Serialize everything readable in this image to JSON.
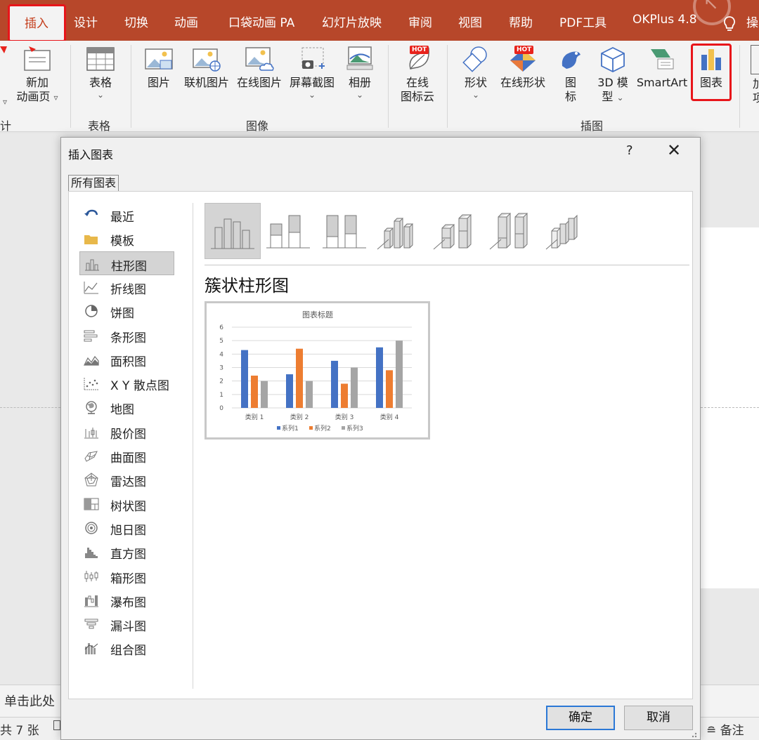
{
  "tabs": [
    {
      "id": "insert",
      "label": "插入"
    },
    {
      "id": "design",
      "label": "设计"
    },
    {
      "id": "transitions",
      "label": "切换"
    },
    {
      "id": "animations",
      "label": "动画"
    },
    {
      "id": "pocket-animation",
      "label": "口袋动画 PA"
    },
    {
      "id": "slideshow",
      "label": "幻灯片放映"
    },
    {
      "id": "review",
      "label": "审阅"
    },
    {
      "id": "view",
      "label": "视图"
    },
    {
      "id": "help",
      "label": "帮助"
    },
    {
      "id": "pdf-tools",
      "label": "PDF工具"
    },
    {
      "id": "okplus",
      "label": "OKPlus 4.8"
    },
    {
      "id": "cut",
      "label": "操"
    }
  ],
  "ribbon": {
    "new_anim_page": {
      "line1": "新加",
      "line2": "动画页",
      "arrow_left": "▿",
      "arrow_right": "▿"
    },
    "table": {
      "label": "表格",
      "caret": "⌄",
      "group": "表格"
    },
    "image_group": {
      "picture": "图片",
      "online_picture_1": "联机图片",
      "online_picture_2": "在线图片",
      "screenshot": "屏幕截图",
      "album": "相册",
      "caret": "⌄",
      "group": "图像"
    },
    "icon_cloud": {
      "line1": "在线",
      "line2": "图标云",
      "hot": "HOT"
    },
    "illus_group": {
      "shapes": "形状",
      "online_shapes": "在线形状",
      "icons_line1": "图",
      "icons_line2": "标",
      "model3d_line1": "3D 模",
      "model3d_line2": "型",
      "smartart": "SmartArt",
      "chart": "图表",
      "caret": "⌄",
      "hot": "HOT",
      "group": "插图"
    },
    "left_partial_group": "计",
    "right_partial": "加\n项"
  },
  "dialog": {
    "title": "插入图表",
    "help": "?",
    "close": "✕",
    "tab": "所有图表",
    "categories": [
      {
        "label": "最近",
        "icon": "recent-icon"
      },
      {
        "label": "模板",
        "icon": "folder-icon"
      },
      {
        "label": "柱形图",
        "icon": "column-chart-icon"
      },
      {
        "label": "折线图",
        "icon": "line-chart-icon"
      },
      {
        "label": "饼图",
        "icon": "pie-chart-icon"
      },
      {
        "label": "条形图",
        "icon": "bar-chart-icon"
      },
      {
        "label": "面积图",
        "icon": "area-chart-icon"
      },
      {
        "label": "X Y 散点图",
        "icon": "scatter-chart-icon"
      },
      {
        "label": "地图",
        "icon": "globe-icon"
      },
      {
        "label": "股价图",
        "icon": "stock-chart-icon"
      },
      {
        "label": "曲面图",
        "icon": "surface-chart-icon"
      },
      {
        "label": "雷达图",
        "icon": "radar-chart-icon"
      },
      {
        "label": "树状图",
        "icon": "treemap-icon"
      },
      {
        "label": "旭日图",
        "icon": "sunburst-icon"
      },
      {
        "label": "直方图",
        "icon": "histogram-icon"
      },
      {
        "label": "箱形图",
        "icon": "boxplot-icon"
      },
      {
        "label": "瀑布图",
        "icon": "waterfall-icon"
      },
      {
        "label": "漏斗图",
        "icon": "funnel-icon"
      },
      {
        "label": "组合图",
        "icon": "combo-chart-icon"
      }
    ],
    "selected_category": "柱形图",
    "subtypes_count": 7,
    "selected_subtype_title": "簇状柱形图",
    "ok": "确定",
    "cancel": "取消"
  },
  "preview_chart": {
    "chart_data": {
      "type": "bar",
      "title": "图表标题",
      "categories": [
        "类别 1",
        "类别 2",
        "类别 3",
        "类别 4"
      ],
      "series": [
        {
          "name": "系列1",
          "values": [
            4.3,
            2.5,
            3.5,
            4.5
          ],
          "color": "#4472c4"
        },
        {
          "name": "系列2",
          "values": [
            2.4,
            4.4,
            1.8,
            2.8
          ],
          "color": "#ed7d31"
        },
        {
          "name": "系列3",
          "values": [
            2.0,
            2.0,
            3.0,
            5.0
          ],
          "color": "#a5a5a5"
        }
      ],
      "ylim": [
        0,
        6
      ],
      "yticks": [
        "0",
        "1",
        "2",
        "3",
        "4",
        "5",
        "6"
      ],
      "grid": true,
      "legend": "bottom"
    }
  },
  "slide_pane": {
    "notes_placeholder": "单击此处",
    "slide_count": "共 7 张",
    "notes_button": "备注"
  },
  "colors": {
    "accent": "#b7472a",
    "highlight": "#e8151a",
    "selection": "#d4d4d4"
  }
}
